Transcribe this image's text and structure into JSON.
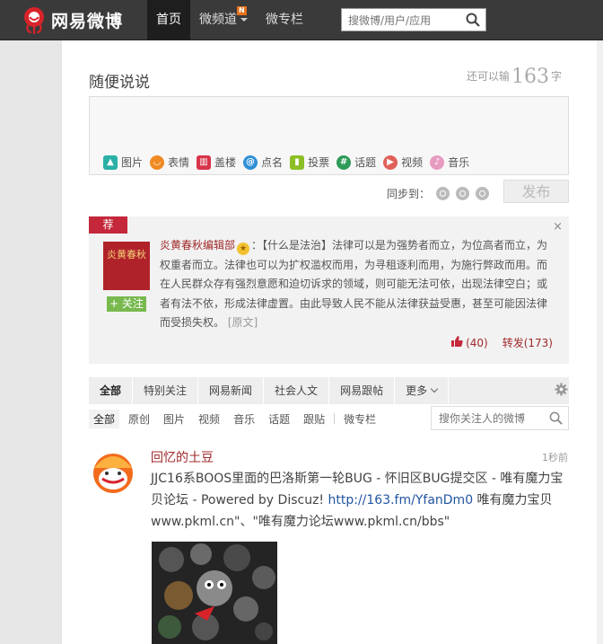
{
  "header": {
    "brand": "网易微博",
    "nav": [
      {
        "label": "首页"
      },
      {
        "label": "微频道",
        "badge": "N"
      },
      {
        "label": "微专栏"
      }
    ],
    "search_placeholder": "搜微博/用户/应用"
  },
  "composer": {
    "title": "随便说说",
    "remain_prefix": "还可以输",
    "remain_count": "163",
    "remain_suffix": "字",
    "tools": [
      {
        "label": "图片",
        "icon": "image-icon",
        "color": "#2ab0a6"
      },
      {
        "label": "表情",
        "icon": "emoji-icon",
        "color": "#f08a24"
      },
      {
        "label": "盖楼",
        "icon": "building-icon",
        "color": "#d8344a"
      },
      {
        "label": "点名",
        "icon": "at-icon",
        "color": "#2f8fd8"
      },
      {
        "label": "投票",
        "icon": "vote-icon",
        "color": "#8cbf26"
      },
      {
        "label": "话题",
        "icon": "topic-icon",
        "color": "#2d9a58"
      },
      {
        "label": "视频",
        "icon": "video-icon",
        "color": "#e0605a"
      },
      {
        "label": "音乐",
        "icon": "music-icon",
        "color": "#e79ac0"
      }
    ],
    "sync_label": "同步到：",
    "publish_label": "发布"
  },
  "recommend": {
    "tag": "荐",
    "close": "×",
    "book_title": "炎黄春秋",
    "follow_label": "+ 关注",
    "author": "炎黄春秋编辑部",
    "author_suffix": "：",
    "body": "【什么是法治】法律可以是为强势者而立，为位高者而立，为权重者而立。法律也可以为扩权滥权而用，为寻租逐利而用，为施行弊政而用。而在人民群众存有强烈意愿和迫切诉求的领域，则可能无法可依，出现法律空白；或者有法不依，形成法律虚置。由此导致人民不能从法律获益受惠，甚至可能因法律而受损失权。",
    "original_link": "[原文]",
    "likes": "(40)",
    "repost": "转发(173)"
  },
  "tabs": [
    {
      "label": "全部"
    },
    {
      "label": "特别关注"
    },
    {
      "label": "网易新闻"
    },
    {
      "label": "社会人文"
    },
    {
      "label": "网易跟帖"
    },
    {
      "label": "更多"
    }
  ],
  "subtabs": [
    {
      "label": "全部"
    },
    {
      "label": "原创"
    },
    {
      "label": "图片"
    },
    {
      "label": "视频"
    },
    {
      "label": "音乐"
    },
    {
      "label": "话题"
    },
    {
      "label": "跟贴"
    },
    {
      "label": "微专栏"
    }
  ],
  "feed_search_placeholder": "搜你关注人的微博",
  "feed": {
    "user": "回忆的土豆",
    "time": "1秒前",
    "text_a": "JJC16系BOOS里面的巴洛斯第一轮BUG - 怀旧区BUG提交区 - 唯有魔力宝贝论坛 - Powered by Discuz! ",
    "link": "http://163.fm/YfanDm0",
    "text_b": " 唯有魔力宝贝www.pkml.cn\"、\"唯有魔力论坛www.pkml.cn/bbs\""
  }
}
